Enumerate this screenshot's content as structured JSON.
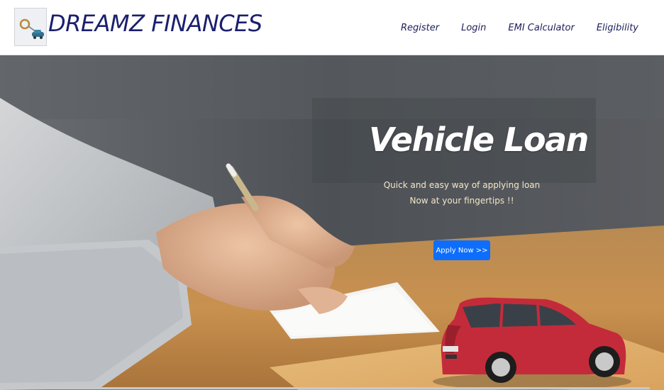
{
  "brand": {
    "name": "DREAMZ FINANCES",
    "logo_icon": "car-key-icon"
  },
  "nav": [
    "Register",
    "Login",
    "EMI Calculator",
    "Eligibility"
  ],
  "hero": {
    "title": "Vehicle Loan",
    "subtitle_line1": "Quick and easy way of applying loan",
    "subtitle_line2": "Now at your fingertips !!",
    "cta_label": "Apply Now >>"
  },
  "colors": {
    "brand": "#1b1f6e",
    "cta": "#0d6efd",
    "subtitle": "#f3e6c9"
  }
}
